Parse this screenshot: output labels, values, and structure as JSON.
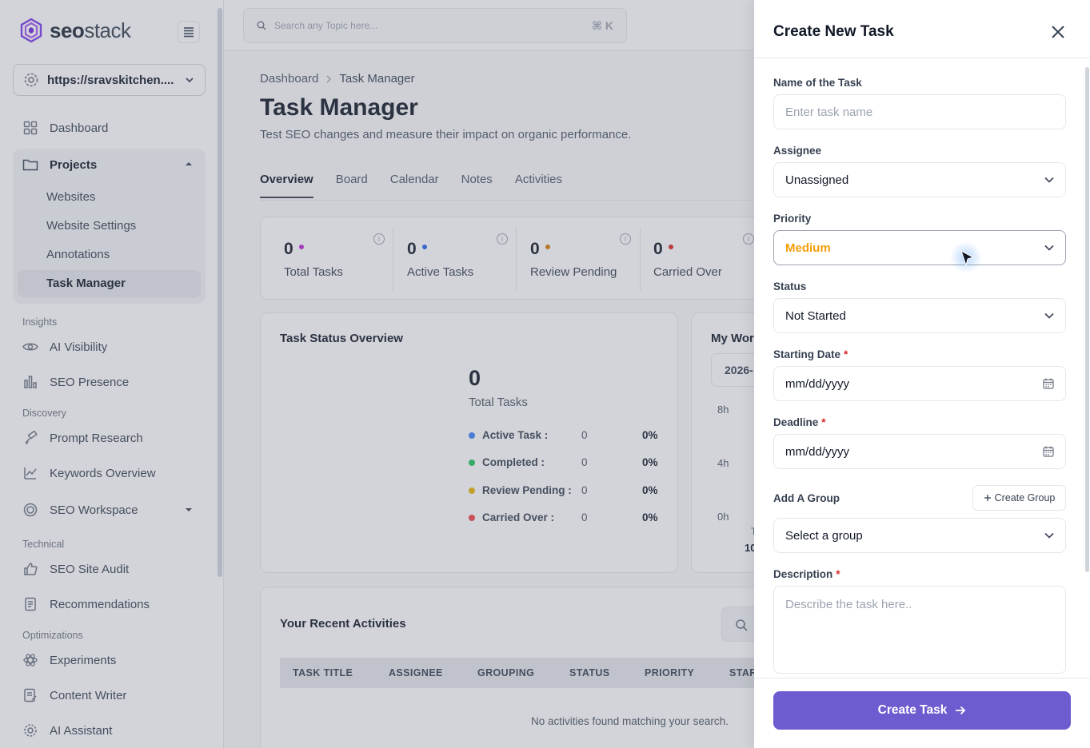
{
  "sidebar": {
    "logo_brand": "seo",
    "logo_brand_light": "stack",
    "site_url": "https://sravskitchen....",
    "dashboard": "Dashboard",
    "projects": "Projects",
    "projects_sub": [
      "Websites",
      "Website Settings",
      "Annotations",
      "Task Manager"
    ],
    "sections": {
      "insights": "Insights",
      "discovery": "Discovery",
      "technical": "Technical",
      "optimizations": "Optimizations"
    },
    "items": {
      "ai_visibility": "AI Visibility",
      "seo_presence": "SEO Presence",
      "prompt_research": "Prompt Research",
      "keywords_overview": "Keywords Overview",
      "seo_workspace": "SEO Workspace",
      "seo_site_audit": "SEO Site Audit",
      "recommendations": "Recommendations",
      "experiments": "Experiments",
      "content_writer": "Content Writer",
      "ai_assistant": "AI Assistant"
    }
  },
  "topbar": {
    "search_placeholder": "Search any Topic here...",
    "shortcut": "⌘ K"
  },
  "page": {
    "breadcrumb": [
      "Dashboard",
      "Task Manager"
    ],
    "title": "Task Manager",
    "subtitle": "Test SEO changes and measure their impact on organic performance.",
    "tabs": [
      "Overview",
      "Board",
      "Calendar",
      "Notes",
      "Activities"
    ]
  },
  "stats": [
    {
      "value": "0",
      "label": "Total Tasks",
      "color": "#c026d3"
    },
    {
      "value": "0",
      "label": "Active Tasks",
      "color": "#2563eb"
    },
    {
      "value": "0",
      "label": "Review Pending",
      "color": "#d97706"
    },
    {
      "value": "0",
      "label": "Carried Over",
      "color": "#dc2626"
    }
  ],
  "status_overview": {
    "title": "Task Status Overview",
    "total_value": "0",
    "total_label": "Total Tasks",
    "legend": [
      {
        "name": "Active Task :",
        "count": "0",
        "pct": "0%",
        "color": "#3b82f6"
      },
      {
        "name": "Completed :",
        "count": "0",
        "pct": "0%",
        "color": "#22c55e"
      },
      {
        "name": "Review Pending :",
        "count": "0",
        "pct": "0%",
        "color": "#eab308"
      },
      {
        "name": "Carried Over :",
        "count": "0",
        "pct": "0%",
        "color": "#ef4444"
      }
    ]
  },
  "workload": {
    "title": "My Wor",
    "date": "2026-",
    "y_ticks": [
      "8h",
      "4h",
      "0h"
    ],
    "x_partial": "T",
    "x_partial2": "10"
  },
  "activities": {
    "title": "Your Recent Activities",
    "columns": [
      "TASK TITLE",
      "ASSIGNEE",
      "GROUPING",
      "STATUS",
      "PRIORITY",
      "STAR"
    ],
    "empty": "No activities found matching your search."
  },
  "drawer": {
    "title": "Create New Task",
    "task_name_label": "Name of the Task",
    "task_name_placeholder": "Enter task name",
    "assignee_label": "Assignee",
    "assignee_value": "Unassigned",
    "priority_label": "Priority",
    "priority_value": "Medium",
    "priority_color": "#f59e0b",
    "status_label": "Status",
    "status_value": "Not Started",
    "start_label": "Starting Date",
    "start_value": "mm/dd/yyyy",
    "deadline_label": "Deadline",
    "deadline_value": "mm/dd/yyyy",
    "group_label": "Add A Group",
    "create_group": "Create Group",
    "group_value": "Select a group",
    "description_label": "Description",
    "description_placeholder": "Describe the task here..",
    "required_mark": "*",
    "submit": "Create Task"
  },
  "colors": {
    "accent": "#6d5bd0"
  }
}
